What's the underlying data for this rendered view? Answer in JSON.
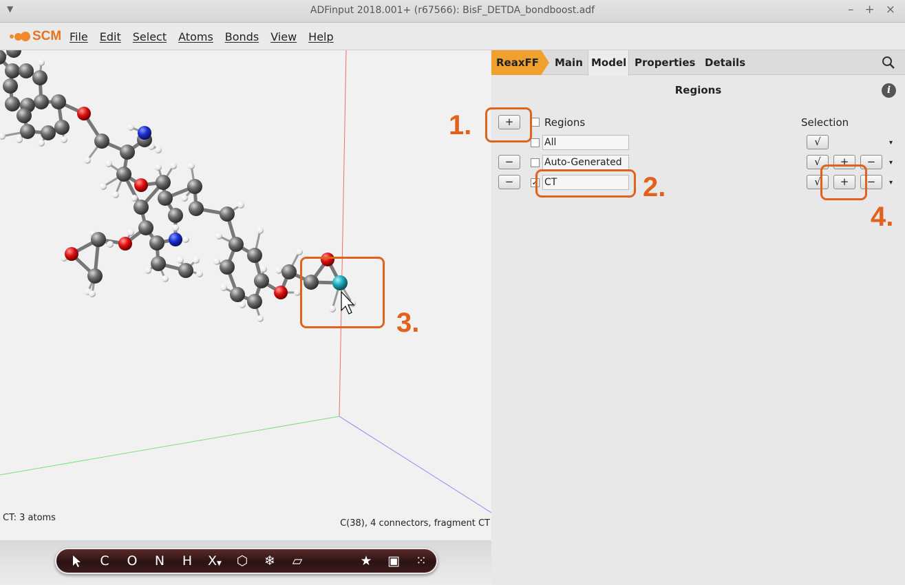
{
  "window": {
    "title": "ADFinput 2018.001+ (r67566): BisF_DETDA_bondboost.adf",
    "menu_icon": "chevron-down-icon",
    "controls": [
      "–",
      "+",
      "×"
    ]
  },
  "menubar": {
    "logo_text": "SCM",
    "items": [
      "File",
      "Edit",
      "Select",
      "Atoms",
      "Bonds",
      "View",
      "Help"
    ]
  },
  "viewport": {
    "status_left": "CT: 3 atoms",
    "status_right": "C(38), 4 connectors, fragment CT"
  },
  "toolbar": {
    "tools": [
      "C",
      "O",
      "N",
      "H",
      "X",
      "⬡",
      "❄",
      "▱"
    ],
    "right_tools": [
      "★",
      "▣",
      "⁙"
    ],
    "pointer_icon": "arrow-pointer-icon"
  },
  "panel": {
    "tabs": [
      "ReaxFF",
      "Main",
      "Model",
      "Properties",
      "Details"
    ],
    "active_tab": "Model",
    "section_title": "Regions",
    "info_icon": "i",
    "header_regions": "Regions",
    "header_selection": "Selection",
    "rows": [
      {
        "name": "All",
        "checked": false
      },
      {
        "name": "Auto-Generated",
        "checked": false
      },
      {
        "name": "CT",
        "checked": true
      }
    ],
    "btn_plus": "+",
    "btn_minus": "−",
    "btn_check": "√",
    "dropdown": "▾",
    "checkmark": "✓"
  },
  "annotations": [
    "1.",
    "2.",
    "3.",
    "4."
  ],
  "colors": {
    "accent_orange": "#e2611c",
    "reaxff_tab": "#f0a02e",
    "carbon": "#6b6b6b",
    "oxygen": "#e01010",
    "nitrogen": "#1a2fd0",
    "hydrogen": "#ffffff",
    "selected_atom": "#19a9b8"
  }
}
